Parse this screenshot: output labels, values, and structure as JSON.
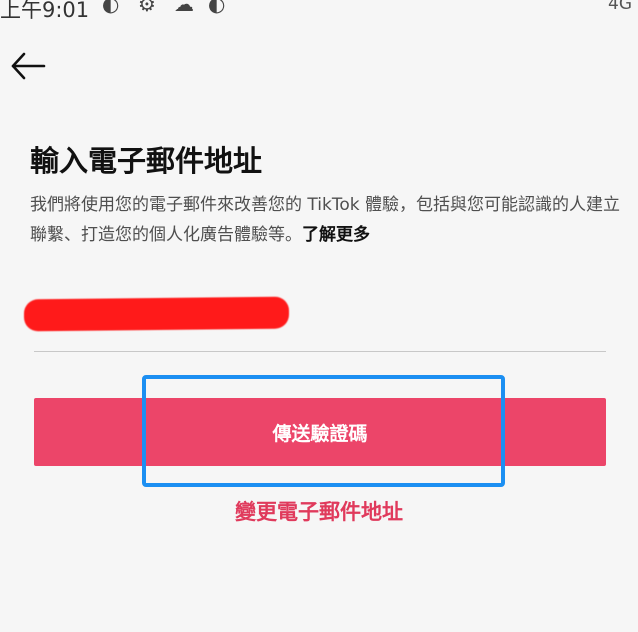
{
  "status_bar": {
    "time": "上午9:01",
    "icons_left": [
      "app-notification-icon",
      "gear-icon",
      "cloud-icon",
      "app-notification-icon"
    ],
    "right_indicators": "4G"
  },
  "header": {
    "back_icon": "arrow-left-icon"
  },
  "main": {
    "title": "輸入電子郵件地址",
    "description": "我們將使用您的電子郵件來改善您的 TikTok 體驗，包括與您可能認識的人建立聯繫、打造您的個人化廣告體驗等。",
    "learn_more": "了解更多",
    "email_field": {
      "value_redacted": true
    },
    "send_button_label": "傳送驗證碼",
    "change_email_label": "變更電子郵件地址"
  },
  "colors": {
    "accent": "#ec4569",
    "link": "#e03a5c",
    "highlight": "#1c8ff2",
    "redaction": "#ff1a1a"
  }
}
